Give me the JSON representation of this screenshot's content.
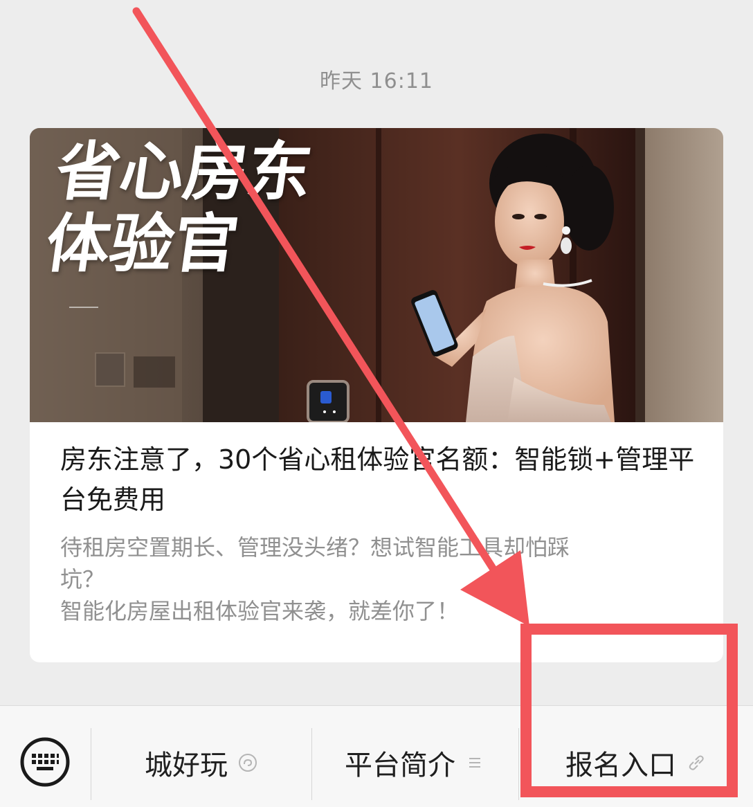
{
  "chat": {
    "timestamp": "昨天 16:11"
  },
  "article": {
    "cover_title_line1": "省心房东",
    "cover_title_line2": "体验官",
    "title": "房东注意了，30个省心租体验官名额：智能锁+管理平台免费用",
    "description_lines": [
      "待租房空置期长、管理没头绪？想试智能工具却怕踩",
      "坑？",
      "智能化房屋出租体验官来袭，就差你了！"
    ]
  },
  "menu": {
    "keyboard_icon": "keyboard-icon",
    "items": [
      {
        "label": "城好玩",
        "icon": "mini-program-icon"
      },
      {
        "label": "平台简介",
        "icon": "submenu-icon"
      },
      {
        "label": "报名入口",
        "icon": "link-icon"
      }
    ]
  },
  "annotation": {
    "color": "#f2555a"
  }
}
